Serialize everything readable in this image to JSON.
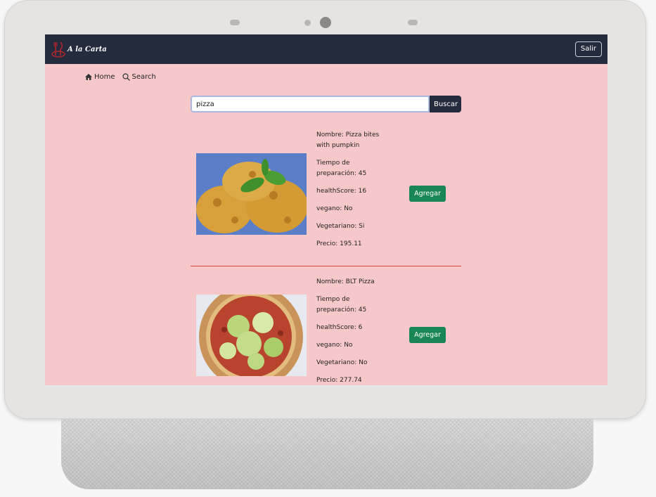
{
  "navbar": {
    "brand": "A la Carta",
    "logout_label": "Salir"
  },
  "breadcrumb": {
    "home_label": "Home",
    "search_label": "Search"
  },
  "search": {
    "value": "pizza",
    "button_label": "Buscar"
  },
  "results": [
    {
      "nombre": "Nombre: Pizza bites with pumpkin",
      "tiempo": "Tiempo de preparación: 45",
      "health": "healthScore: 16",
      "vegano": "vegano: No",
      "vegetariano": "Vegetariano: Si",
      "precio": "Precio: 195.11",
      "button_label": "Agregar"
    },
    {
      "nombre": "Nombre: BLT Pizza",
      "tiempo": "Tiempo de preparación: 45",
      "health": "healthScore: 6",
      "vegano": "vegano: No",
      "vegetariano": "Vegetariano: No",
      "precio": "Precio: 277.74",
      "button_label": "Agregar"
    }
  ],
  "colors": {
    "navbar": "#242b3d",
    "background": "#f7c8c9",
    "accent_green": "#198754",
    "divider": "#d9413e"
  },
  "icons": [
    "home-icon",
    "search-icon",
    "restaurant-logo-icon"
  ]
}
